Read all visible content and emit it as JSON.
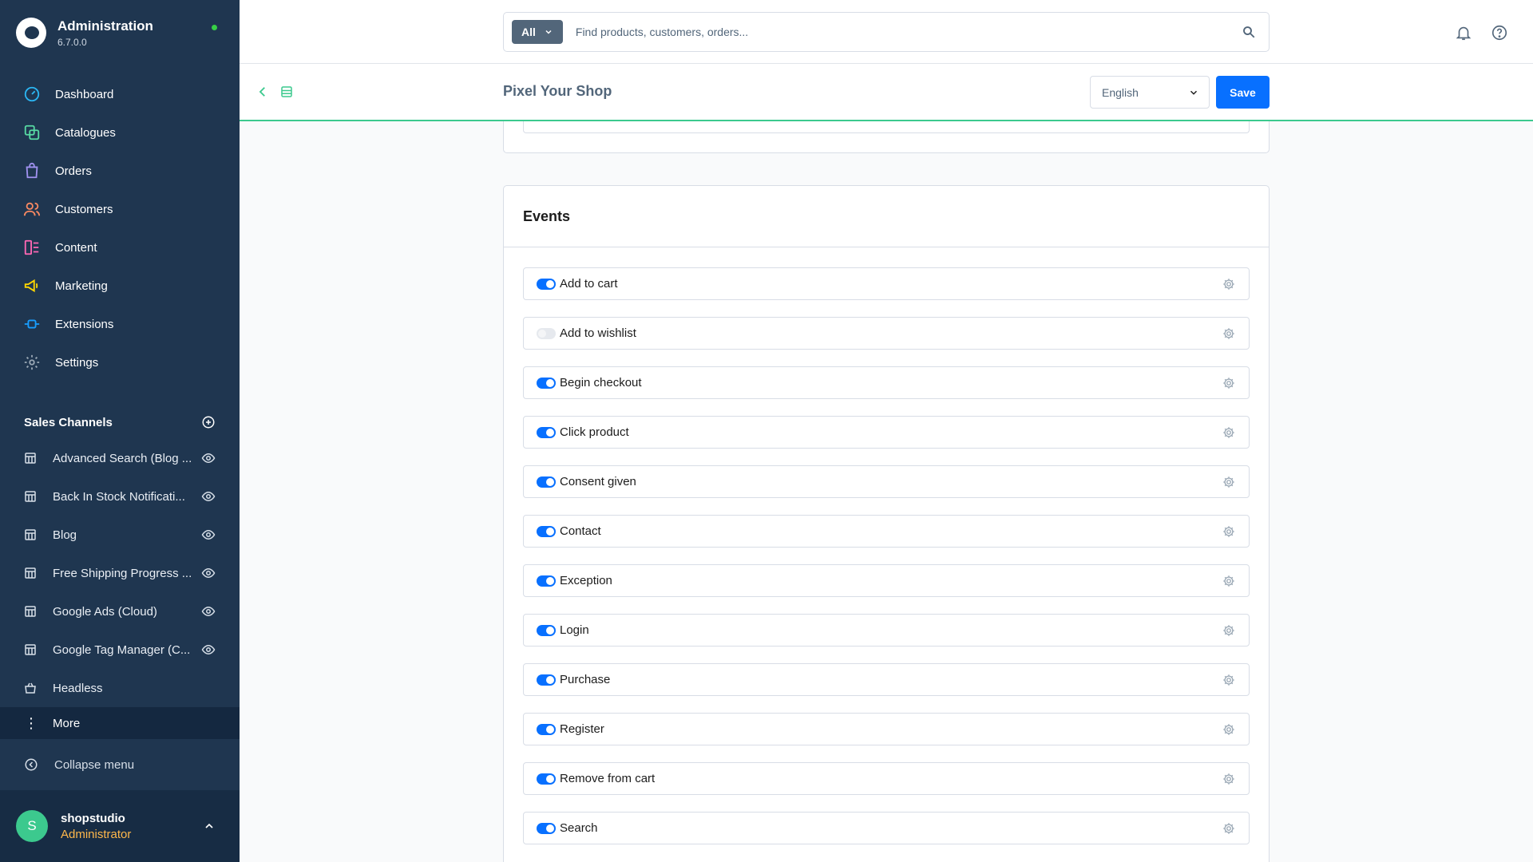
{
  "app": {
    "title": "Administration",
    "version": "6.7.0.0"
  },
  "nav": [
    {
      "label": "Dashboard",
      "icon": "dashboard-icon",
      "color": "#2bb6f3"
    },
    {
      "label": "Catalogues",
      "icon": "catalogue-icon",
      "color": "#57d9a3"
    },
    {
      "label": "Orders",
      "icon": "orders-icon",
      "color": "#a092f0"
    },
    {
      "label": "Customers",
      "icon": "customers-icon",
      "color": "#f88962"
    },
    {
      "label": "Content",
      "icon": "content-icon",
      "color": "#ff68b4"
    },
    {
      "label": "Marketing",
      "icon": "marketing-icon",
      "color": "#ffd700"
    },
    {
      "label": "Extensions",
      "icon": "extensions-icon",
      "color": "#189eff"
    },
    {
      "label": "Settings",
      "icon": "settings-icon",
      "color": "#9aa8b5"
    }
  ],
  "sales_channels": {
    "title": "Sales Channels",
    "items": [
      {
        "label": "Advanced Search (Blog ..."
      },
      {
        "label": "Back In Stock Notificati..."
      },
      {
        "label": "Blog"
      },
      {
        "label": "Free Shipping Progress ..."
      },
      {
        "label": "Google Ads (Cloud)"
      },
      {
        "label": "Google Tag Manager (C..."
      },
      {
        "label": "Headless"
      }
    ],
    "more_label": "More",
    "collapse_label": "Collapse menu"
  },
  "user": {
    "initial": "S",
    "name": "shopstudio",
    "role": "Administrator"
  },
  "search": {
    "type_label": "All",
    "placeholder": "Find products, customers, orders..."
  },
  "page": {
    "title": "Pixel Your Shop",
    "language": "English",
    "save_label": "Save"
  },
  "events": {
    "title": "Events",
    "items": [
      {
        "label": "Add to cart",
        "enabled": true
      },
      {
        "label": "Add to wishlist",
        "enabled": false
      },
      {
        "label": "Begin checkout",
        "enabled": true
      },
      {
        "label": "Click product",
        "enabled": true
      },
      {
        "label": "Consent given",
        "enabled": true
      },
      {
        "label": "Contact",
        "enabled": true
      },
      {
        "label": "Exception",
        "enabled": true
      },
      {
        "label": "Login",
        "enabled": true
      },
      {
        "label": "Purchase",
        "enabled": true
      },
      {
        "label": "Register",
        "enabled": true
      },
      {
        "label": "Remove from cart",
        "enabled": true
      },
      {
        "label": "Search",
        "enabled": true
      }
    ]
  },
  "colors": {
    "sidebar_bg": "#1f3650",
    "accent_blue": "#0870ff",
    "accent_green": "#3cc98e",
    "role_orange": "#ffb84b"
  }
}
